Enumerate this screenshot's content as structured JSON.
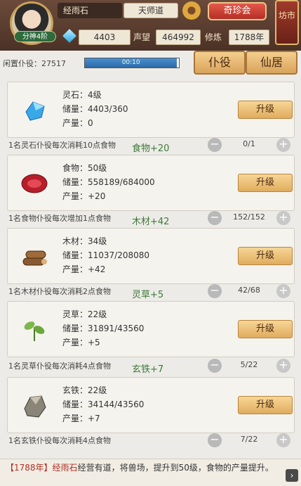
{
  "header": {
    "name": "经雨石",
    "title": "天师道",
    "treasure_label": "奇珍会",
    "fengshi_label": "坊市",
    "rank": "分神4阶",
    "stone": "4403",
    "fame_label": "声望",
    "fame": "464992",
    "cult_label": "修炼",
    "year": "1788年"
  },
  "idle": {
    "label": "闲置仆役：27517",
    "time": "00:10",
    "progress": 0.98
  },
  "tabs": [
    "仆役",
    "仙居"
  ],
  "cards": [
    {
      "name": "灵石：4级",
      "storage": "储量：4403/360",
      "output": "产量：0",
      "upgrade": "升级",
      "row_text": "1名灵石仆役每次消耗10点食物",
      "row_change": "食物+20",
      "count": "0/1"
    },
    {
      "name": "食物：50级",
      "storage": "储量：558189/684000",
      "output": "产量：+20",
      "upgrade": "升级",
      "row_text": "1名食物仆役每次增加1点食物",
      "row_change": "木材+42",
      "count": "152/152"
    },
    {
      "name": "木材：34级",
      "storage": "储量：11037/208080",
      "output": "产量：+42",
      "upgrade": "升级",
      "row_text": "1名木材仆役每次消耗2点食物",
      "row_change": "灵草+5",
      "count": "42/68"
    },
    {
      "name": "灵草：22级",
      "storage": "储量：31891/43560",
      "output": "产量：+5",
      "upgrade": "升级",
      "row_text": "1名灵草仆役每次消耗4点食物",
      "row_change": "玄铁+7",
      "count": "5/22"
    },
    {
      "name": "玄铁：22级",
      "storage": "储量：34144/43560",
      "output": "产量：+7",
      "upgrade": "升级",
      "row_text": "1名玄铁仆役每次消耗4点食物",
      "row_change": "",
      "count": "7/22"
    }
  ],
  "footer": {
    "year": "【1788年】",
    "who": "经雨石",
    "text": "经营有道，将兽场，提升到50级，食物的产量提升。"
  },
  "colors": {
    "accent": "#b23025",
    "button": "#e0ac5e"
  }
}
